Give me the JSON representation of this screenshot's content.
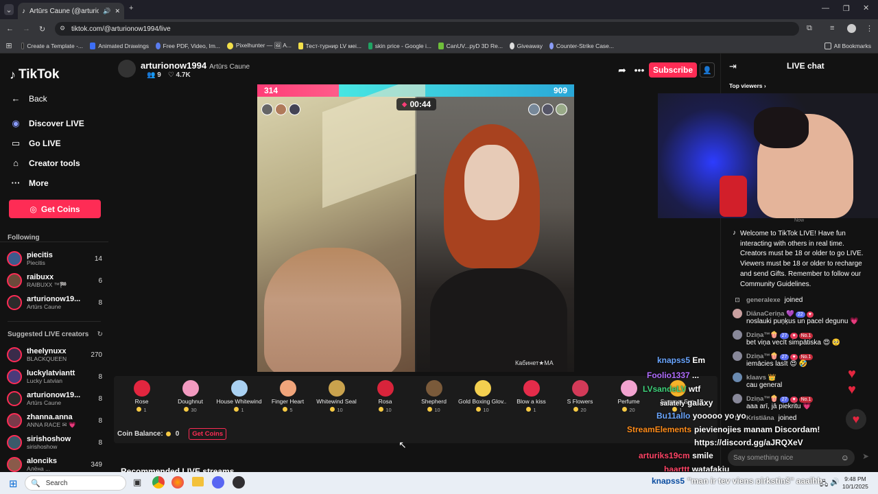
{
  "browser": {
    "tab_title": "Artūrs Caune (@arturionow1994) | TikTok",
    "url": "tiktok.com/@arturionow1994/live",
    "bookmarks": [
      "Create a Template -...",
      "Animated Drawings",
      "Free PDF, Video, Im...",
      "Pixelhunter — 🖼 A...",
      "Тест-турнир LV меі...",
      "skin price - Google i...",
      "CanUV...pyD 3D Re...",
      "Giveaway",
      "Counter-Strike Case..."
    ],
    "all_bookmarks": "All Bookmarks"
  },
  "sidebar": {
    "logo": "TikTok",
    "nav": [
      {
        "label": "Back",
        "icon": "←"
      },
      {
        "label": "Discover LIVE",
        "icon": "◉"
      },
      {
        "label": "Go LIVE",
        "icon": "▭"
      },
      {
        "label": "Creator tools",
        "icon": "⌂"
      },
      {
        "label": "More",
        "icon": "···"
      }
    ],
    "get_coins": "Get Coins",
    "following_title": "Following",
    "following": [
      {
        "name": "piecitis",
        "sub": "Piecitis",
        "count": "14"
      },
      {
        "name": "raibuxx",
        "sub": "RAIBUXX ™🏁",
        "count": "6"
      },
      {
        "name": "arturionow19...",
        "sub": "Artūrs Caune",
        "count": "8"
      }
    ],
    "suggested_title": "Suggested LIVE creators",
    "suggested": [
      {
        "name": "theelynuxx",
        "sub": "BLACKQUEEN",
        "count": "270"
      },
      {
        "name": "luckylatviantt",
        "sub": "Lucky Latvian",
        "count": "8"
      },
      {
        "name": "arturionow19...",
        "sub": "Artūrs Caune",
        "count": "8"
      },
      {
        "name": "zhanna.anna",
        "sub": "ANNA RACE ✉ 💗",
        "count": "8"
      },
      {
        "name": "sirishoshow",
        "sub": "sirishoshow",
        "count": "8"
      },
      {
        "name": "alonciks",
        "sub": "Алёна ...",
        "count": "349"
      }
    ]
  },
  "stream": {
    "username": "arturionow1994",
    "display_name": "Artūrs Caune",
    "viewers": "9",
    "likes": "4.7K",
    "subscribe": "Subscribe",
    "score_left": "314",
    "score_right": "909",
    "score_left_fraction": 0.257,
    "timer": "00:44",
    "watermark": "Кабинет★МА"
  },
  "gifts": [
    {
      "name": "Rose",
      "price": "1",
      "color": "#e3263f"
    },
    {
      "name": "Doughnut",
      "price": "30",
      "color": "#f29ac0"
    },
    {
      "name": "House Whitewind",
      "price": "1",
      "color": "#a9d1f2"
    },
    {
      "name": "Finger Heart",
      "price": "5",
      "color": "#f1a57b"
    },
    {
      "name": "Whitewind Seal",
      "price": "10",
      "color": "#c9a24d"
    },
    {
      "name": "Rosa",
      "price": "10",
      "color": "#d8243b"
    },
    {
      "name": "Shepherd",
      "price": "10",
      "color": "#7a5a3a"
    },
    {
      "name": "Gold Boxing Glov...",
      "price": "10",
      "color": "#f3cf4f"
    },
    {
      "name": "Blow a kiss",
      "price": "1",
      "color": "#e52c4a"
    },
    {
      "name": "S Flowers",
      "price": "20",
      "color": "#d33a58"
    },
    {
      "name": "Perfume",
      "price": "20",
      "color": "#f2a3d0"
    },
    {
      "name": "Summer Sun",
      "price": "1",
      "color": "#f5b32a"
    }
  ],
  "coin_balance": {
    "label": "Coin Balance:",
    "value": "0",
    "button": "Get Coins"
  },
  "recommended": "Recommended LIVE streams",
  "overlay_chat": [
    {
      "user": "knapss5",
      "text": "Em",
      "color": "#6aa6ff"
    },
    {
      "user": "Foolio1337",
      "text": "...",
      "color": "#b16cff"
    },
    {
      "user": "LVsandeLV",
      "text": "wtf",
      "color": "#3ed17a"
    },
    {
      "user": "salately",
      "text": "galãxy",
      "color": "#ffffff"
    },
    {
      "user": "Bu11allo",
      "text": "yooooo yo yo",
      "color": "#6aa6ff"
    },
    {
      "user": "",
      "text": "pievienojies manam Discordam!",
      "color": "#ffffff"
    },
    {
      "user": "StreamElements",
      "text": "",
      "color": "#ff8c1a"
    },
    {
      "user": "",
      "text": "https://discord.gg/aJRQXeV",
      "color": "#ffffff"
    },
    {
      "user": "arturiks19cm",
      "text": "smile",
      "color": "#ff4466"
    },
    {
      "user": "haarttt",
      "text": "watafakju",
      "color": "#ff4466"
    },
    {
      "user": "knapss5",
      "text": "\"man ir tev viens pirkstiņš\" aaaihh",
      "color": "#6aa6ff"
    }
  ],
  "chat": {
    "title": "LIVE chat",
    "top_viewers": "Top viewers",
    "now": "Now",
    "welcome": "Welcome to TikTok LIVE! Have fun interacting with others in real time. Creators must be 18 or older to go LIVE. Viewers must be 18 or older to recharge and send Gifts. Remember to follow our Community Guidelines.",
    "messages": [
      {
        "type": "join",
        "user": "generalexe",
        "text": "joined"
      },
      {
        "type": "msg",
        "user": "DiānaCeriņa 💜",
        "badge": "22",
        "text": "noslauki puņķus un pacel degunu 💗"
      },
      {
        "type": "msg",
        "user": "Dziņa™🍿",
        "badge": "27",
        "badge2": "No.1",
        "text": "bet viņa vecīt simpātiska 😍 🥺"
      },
      {
        "type": "msg",
        "user": "Dziņa™🍿",
        "badge": "27",
        "badge2": "No.1",
        "text": "iemācies lasīt 😍 🤣"
      },
      {
        "type": "msg",
        "user": "klaavs 👑",
        "badge": "",
        "text": "cau general"
      },
      {
        "type": "msg",
        "user": "Dziņa™🍿",
        "badge": "27",
        "badge2": "No.1",
        "text": "aaa arī, jā piekritu 💗"
      },
      {
        "type": "join",
        "user": "Kristiāna",
        "text": "joined"
      }
    ],
    "input_placeholder": "Say something nice"
  },
  "taskbar": {
    "search": "Search",
    "time": "9:48 PM",
    "date": "10/1/2025"
  }
}
